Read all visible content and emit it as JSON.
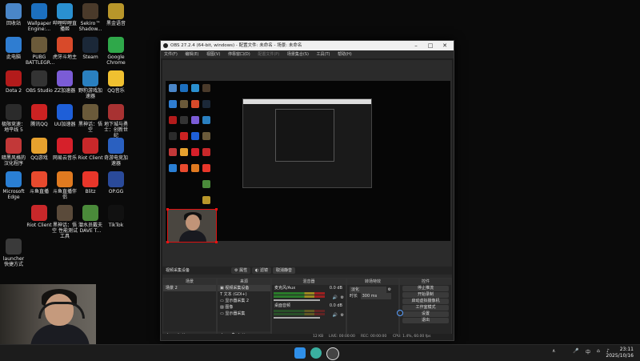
{
  "desktop": {
    "icons": [
      {
        "label": "回收站"
      },
      {
        "label": "此电脑"
      },
      {
        "label": "Dota 2"
      },
      {
        "label": "极限竞速：地平线 5"
      },
      {
        "label": "暗黑风格的汉化程序"
      },
      {
        "label": "Microsoft Edge"
      },
      {
        "label": "launcher 快捷方式"
      },
      {
        "label": "Wallpaper Engine:..."
      },
      {
        "label": "PUBG BATTLEGR..."
      },
      {
        "label": "OBS Studio"
      },
      {
        "label": "腾讯QQ"
      },
      {
        "label": "QQ游戏"
      },
      {
        "label": "斗鱼直播"
      },
      {
        "label": "Riot Client"
      },
      {
        "label": "哔哩哔哩直播姬"
      },
      {
        "label": "虎牙斗地主"
      },
      {
        "label": "ZZ加速器"
      },
      {
        "label": "UU加速器"
      },
      {
        "label": "网易云音乐"
      },
      {
        "label": "斗鱼直播伴侣"
      },
      {
        "label": "黑神话：悟空 性能测试工具"
      },
      {
        "label": "Sekiro™ Shadow..."
      },
      {
        "label": "Steam"
      },
      {
        "label": "野豹游戏加速器"
      },
      {
        "label": "黑神话：悟空"
      },
      {
        "label": "Riot Client"
      },
      {
        "label": "Blitz"
      },
      {
        "label": "潜水员戴夫 DAVE T..."
      },
      {
        "label": "黑金语音"
      },
      {
        "label": "Google Chrome"
      },
      {
        "label": "QQ音乐"
      },
      {
        "label": "地下城与勇士：创新世纪"
      },
      {
        "label": "奇游电竞加速器"
      },
      {
        "label": "OP.GG"
      },
      {
        "label": "TikTok"
      }
    ]
  },
  "obs": {
    "title": "OBS 27.2.4 (64-bit, windows) - 配置文件: 未命名 - 场景: 未命名",
    "menu": [
      "文件(F)",
      "编辑(E)",
      "视图(V)",
      "停靠窗口(D)",
      "配置文件(P)",
      "场景集合(S)",
      "工具(T)",
      "帮助(H)"
    ],
    "source_bar": {
      "source_name": "视频采集设备",
      "properties": "属性",
      "filters": "滤镜",
      "cancel_button": "取消静音"
    },
    "scenes": {
      "title": "场景",
      "items": [
        "场景 2"
      ]
    },
    "sources": {
      "title": "来源",
      "items": [
        "视频采集设备",
        "文本 (GDI+)",
        "显示器采集 2",
        "图像",
        "显示器采集"
      ]
    },
    "mixer": {
      "title": "混音器",
      "channels": [
        {
          "name": "麦克风/Aux",
          "db": "0.0 dB"
        },
        {
          "name": "桌面音频",
          "db": "0.0 dB"
        }
      ]
    },
    "transitions": {
      "title": "转场特效",
      "type": "淡化",
      "duration_label": "时长",
      "duration": "300 ms"
    },
    "controls": {
      "title": "控件",
      "buttons": [
        "停止推流",
        "开始录制",
        "启动虚拟摄像机",
        "工作室模式",
        "设置",
        "退出"
      ]
    },
    "status": {
      "live": "LIVE: 00:00:00",
      "rec": "REC: 00:00:00",
      "cpu": "CPU: 1.4%, 60.00 fps",
      "kbps": "12 KB"
    }
  },
  "taskbar": {
    "time": "23:11",
    "date": "2025/10/16",
    "tray_text": "中"
  }
}
